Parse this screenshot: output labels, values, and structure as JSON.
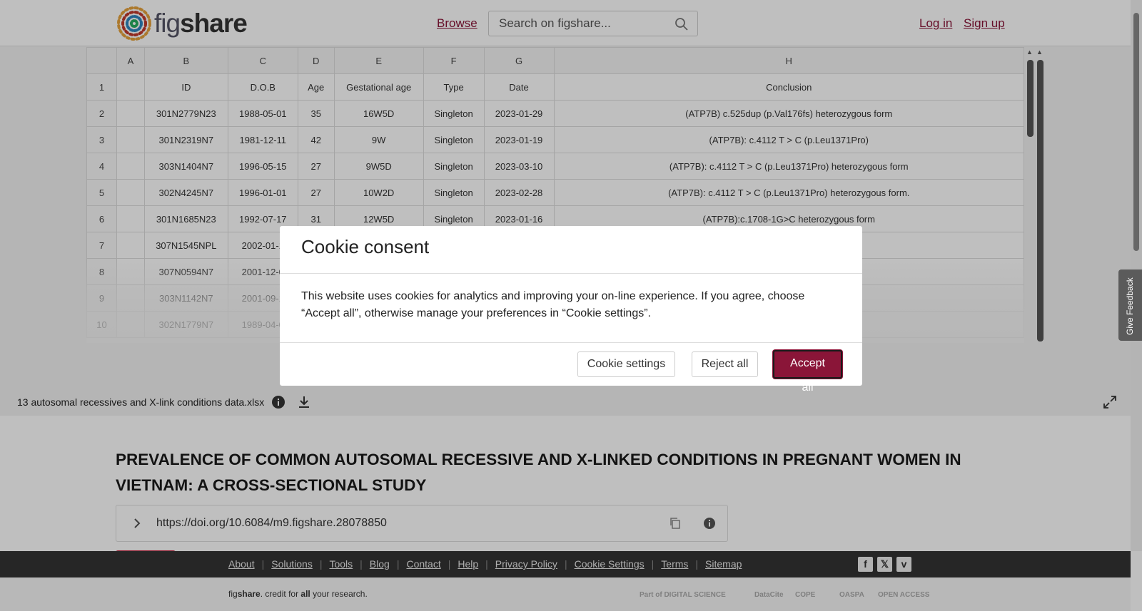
{
  "header": {
    "logo_text_fig": "fig",
    "logo_text_share": "share",
    "browse": "Browse",
    "search_placeholder": "Search on figshare...",
    "login": "Log in",
    "signup": "Sign up"
  },
  "sheet": {
    "col_letters": [
      "",
      "A",
      "B",
      "C",
      "D",
      "E",
      "F",
      "G",
      "H"
    ],
    "rows": [
      [
        "1",
        "",
        "ID",
        "D.O.B",
        "Age",
        "Gestational age",
        "Type",
        "Date",
        "Conclusion"
      ],
      [
        "2",
        "",
        "301N2779N23",
        "1988-05-01",
        "35",
        "16W5D",
        "Singleton",
        "2023-01-29",
        "(ATP7B) c.525dup (p.Val176fs) heterozygous form"
      ],
      [
        "3",
        "",
        "301N2319N7",
        "1981-12-11",
        "42",
        "9W",
        "Singleton",
        "2023-01-19",
        "(ATP7B): c.4112 T > C (p.Leu1371Pro)"
      ],
      [
        "4",
        "",
        "303N1404N7",
        "1996-05-15",
        "27",
        "9W5D",
        "Singleton",
        "2023-03-10",
        "(ATP7B): c.4112 T > C (p.Leu1371Pro) heterozygous form"
      ],
      [
        "5",
        "",
        "302N4245N7",
        "1996-01-01",
        "27",
        "10W2D",
        "Singleton",
        "2023-02-28",
        "(ATP7B): c.4112 T > C (p.Leu1371Pro) heterozygous form."
      ],
      [
        "6",
        "",
        "301N1685N23",
        "1992-07-17",
        "31",
        "12W5D",
        "Singleton",
        "2023-01-16",
        "(ATP7B):c.1708-1G>C heterozygous form"
      ],
      [
        "7",
        "",
        "307N1545NPL",
        "2002-01-1",
        "",
        "",
        "",
        "",
        "rg489Leu) heterozygous form"
      ],
      [
        "8",
        "",
        "307N0594N7",
        "2001-12-0",
        "",
        "",
        "",
        "",
        "rg489Leu) heterozygous form"
      ],
      [
        "9",
        "",
        "303N1142N7",
        "2001-09-1",
        "",
        "",
        "",
        "",
        "rm"
      ],
      [
        "10",
        "",
        "302N1779N7",
        "1989-04-0",
        "",
        "",
        "",
        "",
        "rm"
      ]
    ]
  },
  "file": {
    "name": "13 autosomal recessives and X-link conditions data.xlsx"
  },
  "article": {
    "title": "PREVALENCE OF COMMON AUTOSOMAL RECESSIVE AND X-LINKED CONDITIONS IN PREGNANT WOMEN IN VIETNAM: A CROSS-SECTIONAL STUDY",
    "doi": "https://doi.org/10.6084/m9.figshare.28078850"
  },
  "footer": {
    "links": [
      "About",
      "Solutions",
      "Tools",
      "Blog",
      "Contact",
      "Help",
      "Privacy Policy",
      "Cookie Settings",
      "Terms",
      "Sitemap"
    ],
    "tagline_fig": "fig",
    "tagline_share": "share",
    "tagline_mid": ". credit for ",
    "tagline_all": "all",
    "tagline_end": " your research.",
    "partners": [
      "Part of DIGITAL SCIENCE",
      "DataCite",
      "COPE",
      "OASPA",
      "OPEN ACCESS"
    ]
  },
  "feedback": "Give Feedback",
  "cookie": {
    "title": "Cookie consent",
    "body": "This website uses cookies for analytics and improving your on-line experience. If you agree, choose “Accept all”, otherwise manage your preferences in “Cookie settings”.",
    "settings": "Cookie settings",
    "reject": "Reject all",
    "accept": "Accept all"
  },
  "colors": {
    "brand": "#8a1538",
    "footer_bg": "#333333"
  },
  "icons": [
    "search-icon",
    "info-icon",
    "download-icon",
    "expand-icon",
    "chevron-right-icon",
    "copy-icon",
    "facebook-icon",
    "x-icon",
    "vimeo-icon"
  ]
}
